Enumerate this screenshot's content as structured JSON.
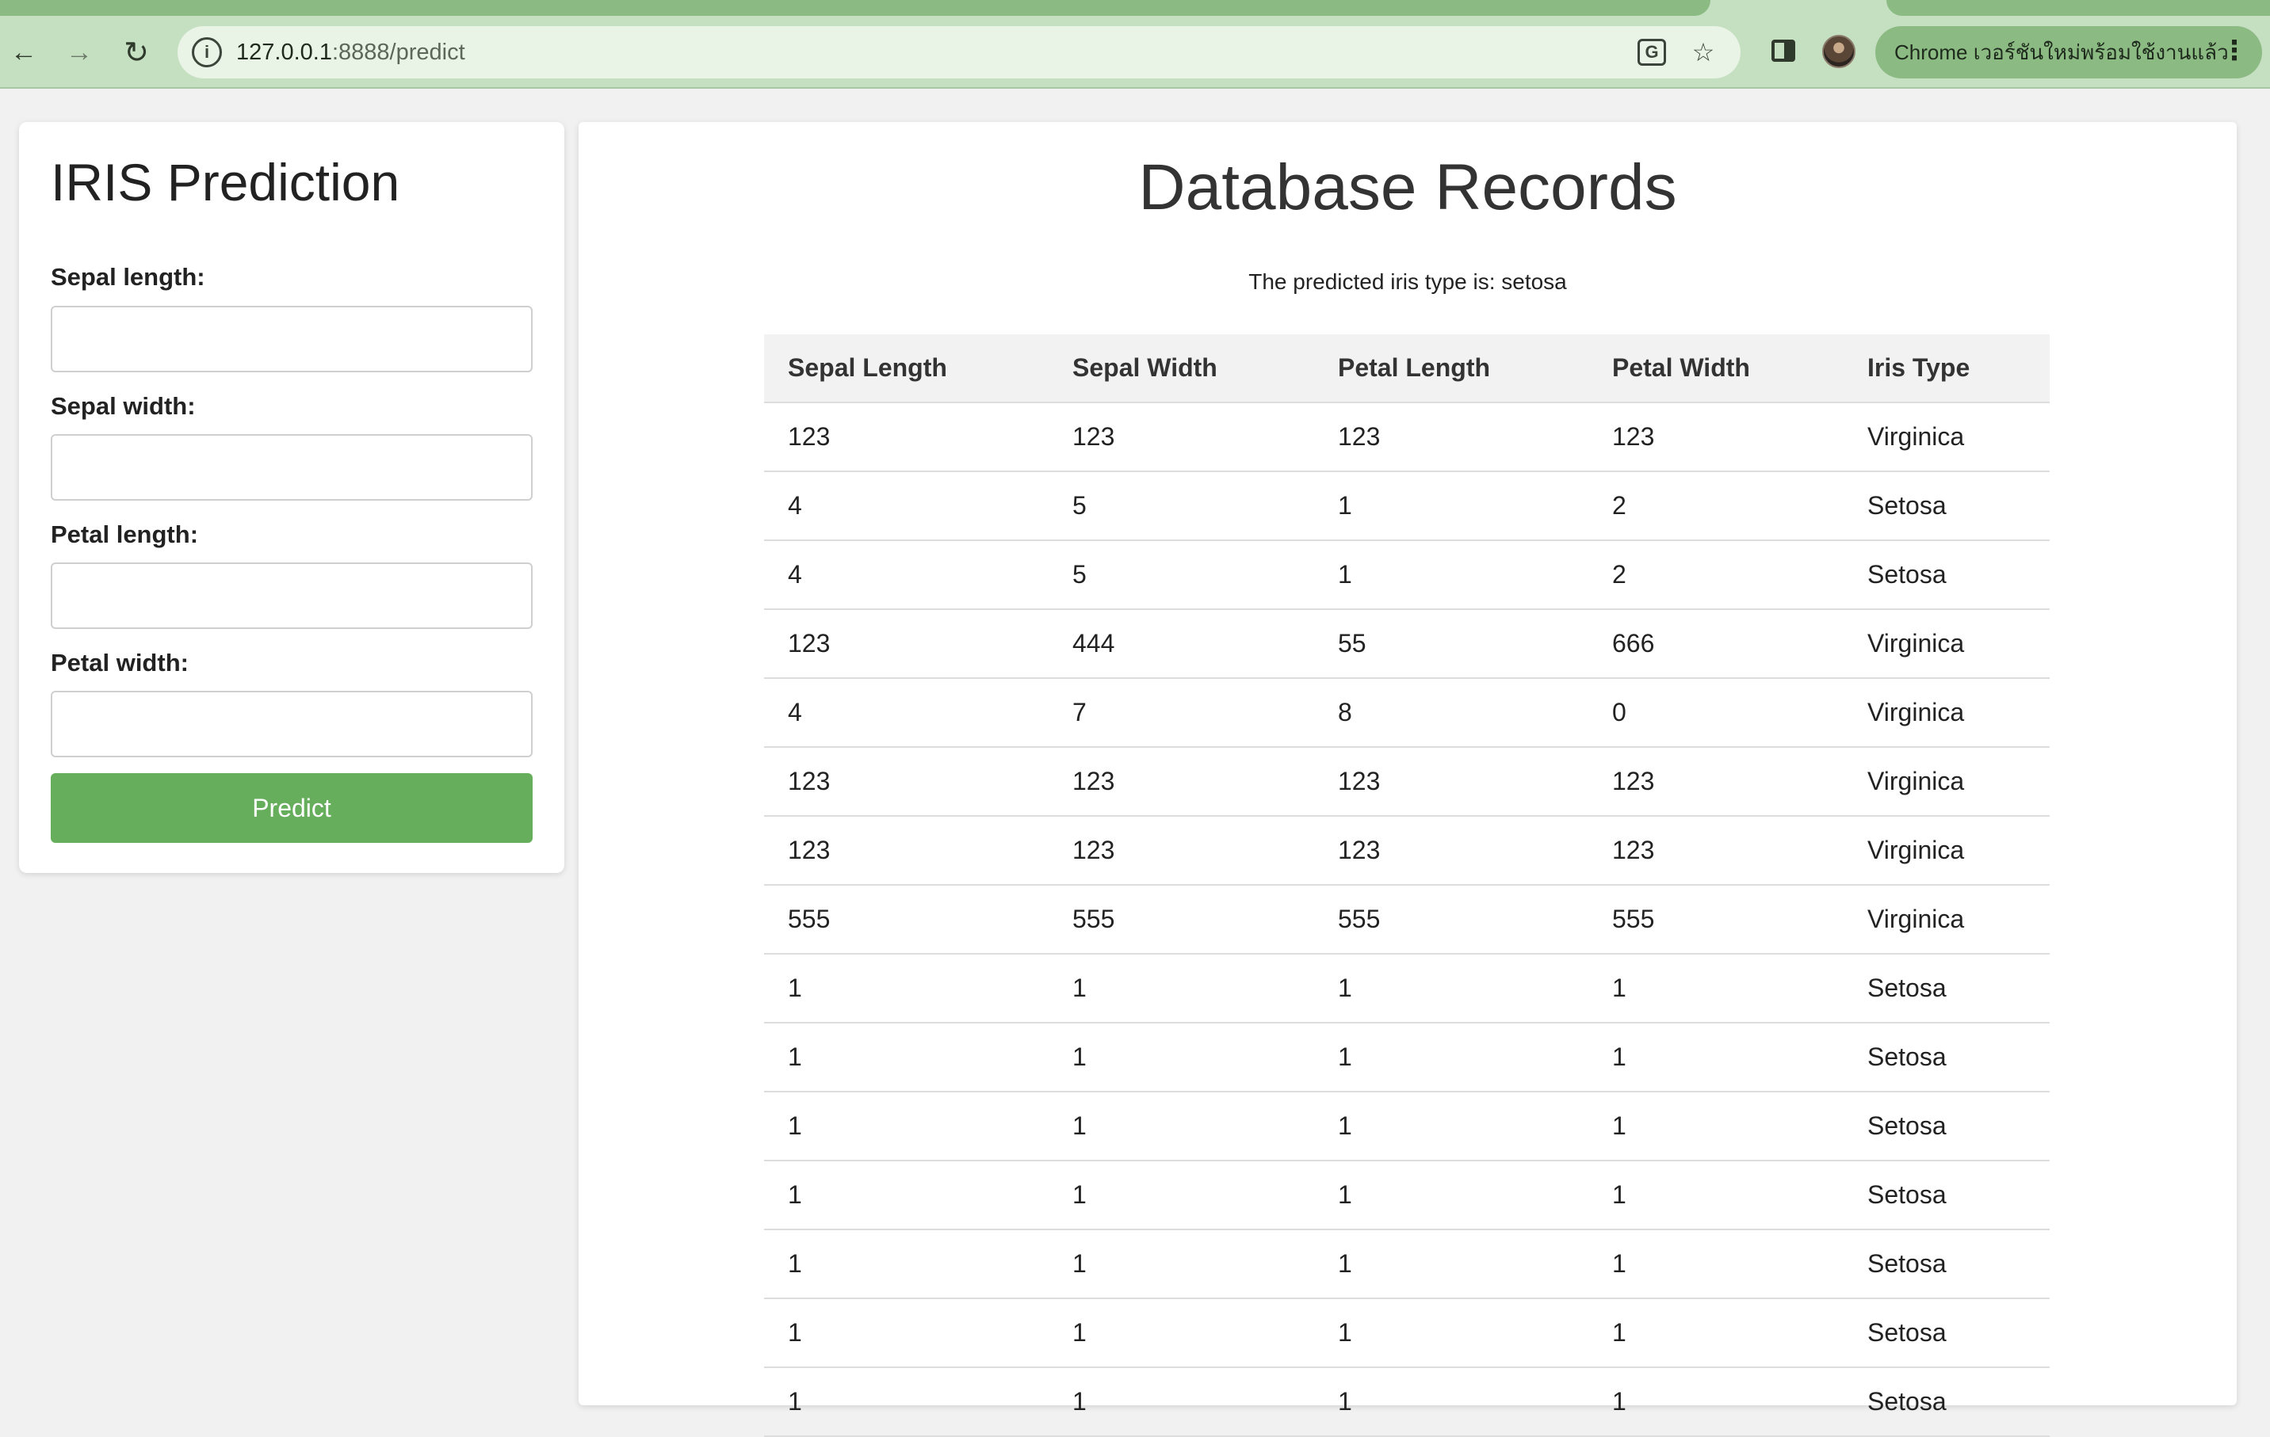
{
  "browser": {
    "url_host": "127.0.0.1",
    "url_path": ":8888/predict",
    "update_button_label": "Chrome เวอร์ชันใหม่พร้อมใช้งานแล้ว",
    "icons": {
      "back": "arrow-left",
      "forward": "arrow-right",
      "reload": "reload",
      "site_info": "info",
      "translate": "translate",
      "bookmark": "star",
      "side_panel": "side-panel",
      "menu": "kebab"
    },
    "accent_color": "#8bba83"
  },
  "form": {
    "title": "IRIS Prediction",
    "fields": [
      {
        "label": "Sepal length:",
        "value": ""
      },
      {
        "label": "Sepal width:",
        "value": ""
      },
      {
        "label": "Petal length:",
        "value": ""
      },
      {
        "label": "Petal width:",
        "value": ""
      }
    ],
    "submit_label": "Predict",
    "button_color": "#66ad5c"
  },
  "records": {
    "title": "Database Records",
    "prediction_text": "The predicted iris type is: setosa",
    "columns": [
      "Sepal Length",
      "Sepal Width",
      "Petal Length",
      "Petal Width",
      "Iris Type"
    ],
    "rows": [
      [
        "123",
        "123",
        "123",
        "123",
        "Virginica"
      ],
      [
        "4",
        "5",
        "1",
        "2",
        "Setosa"
      ],
      [
        "4",
        "5",
        "1",
        "2",
        "Setosa"
      ],
      [
        "123",
        "444",
        "55",
        "666",
        "Virginica"
      ],
      [
        "4",
        "7",
        "8",
        "0",
        "Virginica"
      ],
      [
        "123",
        "123",
        "123",
        "123",
        "Virginica"
      ],
      [
        "123",
        "123",
        "123",
        "123",
        "Virginica"
      ],
      [
        "555",
        "555",
        "555",
        "555",
        "Virginica"
      ],
      [
        "1",
        "1",
        "1",
        "1",
        "Setosa"
      ],
      [
        "1",
        "1",
        "1",
        "1",
        "Setosa"
      ],
      [
        "1",
        "1",
        "1",
        "1",
        "Setosa"
      ],
      [
        "1",
        "1",
        "1",
        "1",
        "Setosa"
      ],
      [
        "1",
        "1",
        "1",
        "1",
        "Setosa"
      ],
      [
        "1",
        "1",
        "1",
        "1",
        "Setosa"
      ],
      [
        "1",
        "1",
        "1",
        "1",
        "Setosa"
      ]
    ]
  }
}
